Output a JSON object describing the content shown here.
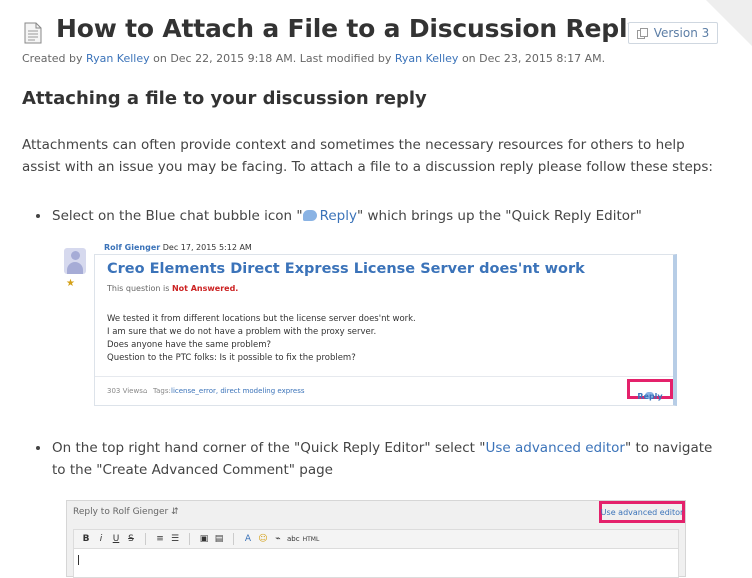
{
  "page": {
    "title": "How to Attach a File to a Discussion Reply",
    "version_label": "Version 3",
    "meta": {
      "created_prefix": "Created by ",
      "created_by": "Ryan Kelley",
      "created_on": " on Dec 22, 2015 9:18 AM. Last modified by ",
      "modified_by": "Ryan Kelley",
      "modified_on": " on Dec 23, 2015 8:17 AM."
    },
    "section_heading": "Attaching a file to your discussion reply",
    "intro": "Attachments can often provide context and sometimes the necessary resources for others to help assist with an issue you may be facing. To attach a file to a discussion reply please follow these steps:",
    "step1": {
      "pre": "Select on the Blue chat bubble icon \"",
      "link": "Reply",
      "post": "\" which brings up the \"Quick Reply Editor\""
    },
    "step2": {
      "pre": "On the top right hand corner of the \"Quick Reply Editor\" select \"",
      "link": "Use advanced editor",
      "post": "\" to navigate to the \"Create Advanced Comment\" page"
    }
  },
  "screenshot1": {
    "author": "Rolf Gienger",
    "date": "Dec 17, 2015 5:12 AM",
    "thread_title": "Creo Elements Direct Express License Server does'nt work",
    "question_prefix": "This question is ",
    "question_status": "Not Answered.",
    "body_lines": [
      "We tested it from different locations but the license server does'nt work.",
      "I am sure that we do not have a problem with the proxy server.",
      "Does anyone have the same problem?",
      "Question to the PTC folks: Is it possible to fix the problem?"
    ],
    "views": "303 Views",
    "tags_label": "Tags:",
    "tags": "license_error, direct modeling express",
    "reply_label": "Reply"
  },
  "screenshot2": {
    "reply_to": "Reply to Rolf Gienger",
    "advanced_editor": "Use advanced editor",
    "toolbar": [
      "B",
      "i",
      "U",
      "S",
      "≡",
      "☰",
      "▣",
      "▤",
      "A",
      "☺",
      "⌁",
      "abc",
      "HTML"
    ]
  },
  "colors": {
    "link": "#3b73b9",
    "highlight": "#e4216b",
    "status_red": "#cc2222"
  }
}
